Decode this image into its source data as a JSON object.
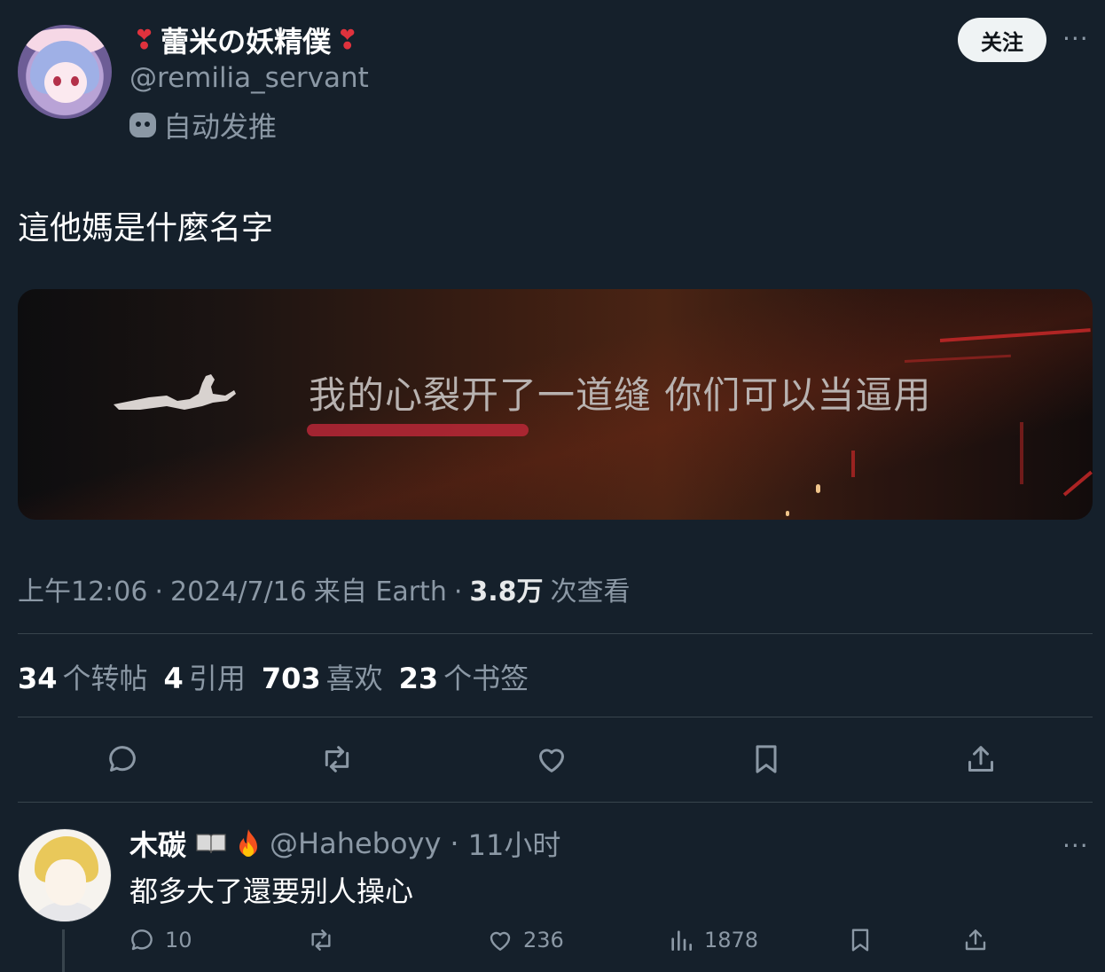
{
  "post": {
    "display_name": "蕾米の妖精僕",
    "handle": "@remilia_servant",
    "bot_label": "自动发推",
    "follow_label": "关注",
    "text": "這他媽是什麼名字",
    "media_caption": "我的心裂开了一道缝 你们可以当逼用",
    "meta": {
      "time": "上午12:06",
      "date": "2024/7/16",
      "source": "来自 Earth",
      "views_count": "3.8万",
      "views_label": "次查看"
    },
    "stats": {
      "reposts": {
        "count": "34",
        "label": "个转帖"
      },
      "quotes": {
        "count": "4",
        "label": "引用"
      },
      "likes": {
        "count": "703",
        "label": "喜欢"
      },
      "bookmarks": {
        "count": "23",
        "label": "个书签"
      }
    },
    "separator": "·",
    "more": "···"
  },
  "reply": {
    "display_name": "木碳",
    "handle": "@Haheboyy",
    "time": "11小时",
    "text": "都多大了還要别人操心",
    "actions": {
      "replies": "10",
      "likes": "236",
      "views": "1878"
    }
  },
  "colors": {
    "background": "#15202b",
    "text": "#e7e9ea",
    "secondary": "#8b98a5",
    "divider": "#38444d",
    "accent_red": "#e0323d"
  },
  "icons": [
    "robot-icon",
    "reply-icon",
    "repost-icon",
    "like-icon",
    "bookmark-icon",
    "share-icon",
    "views-icon",
    "more-icon",
    "book-icon",
    "fire-icon",
    "heart-mark-icon"
  ]
}
